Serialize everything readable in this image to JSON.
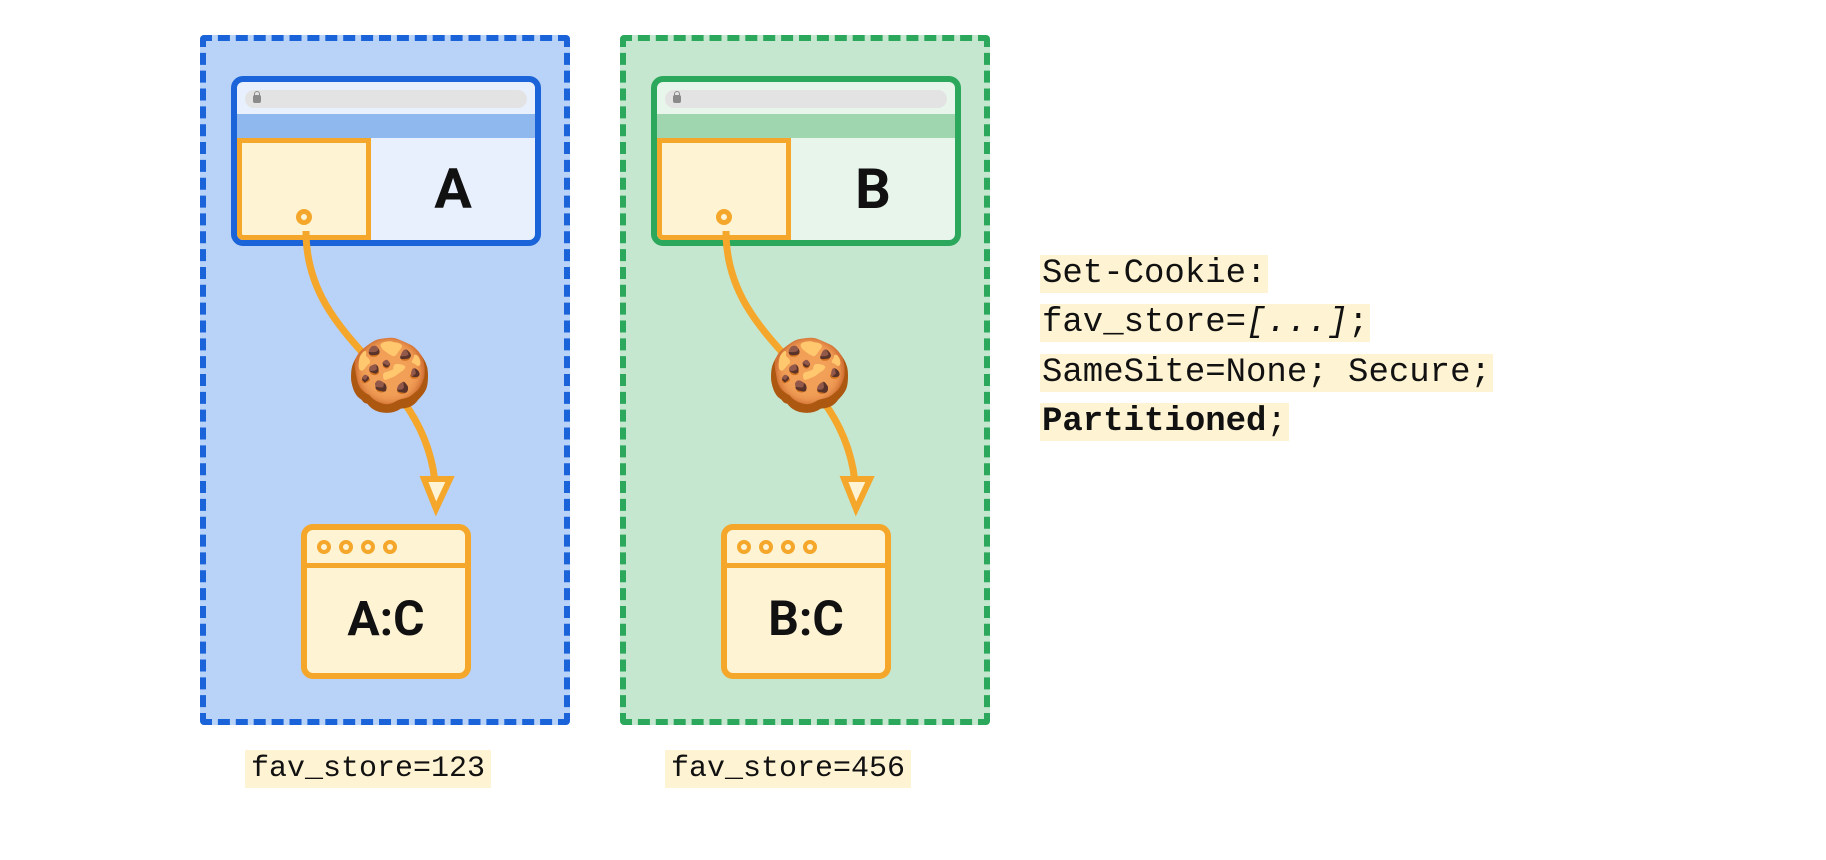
{
  "partitions": {
    "a": {
      "site_label": "A",
      "target_label": "A:C",
      "cookie_value": "fav_store=123"
    },
    "b": {
      "site_label": "B",
      "target_label": "B:C",
      "cookie_value": "fav_store=456"
    }
  },
  "code": {
    "line1": "Set-Cookie:",
    "line2_pre": "fav_store=",
    "line2_val": "[...]",
    "line2_post": ";",
    "line3": "SameSite=None; Secure;",
    "line4": "Partitioned",
    "line4_post": ";"
  },
  "icons": {
    "cookie": "🍪"
  }
}
